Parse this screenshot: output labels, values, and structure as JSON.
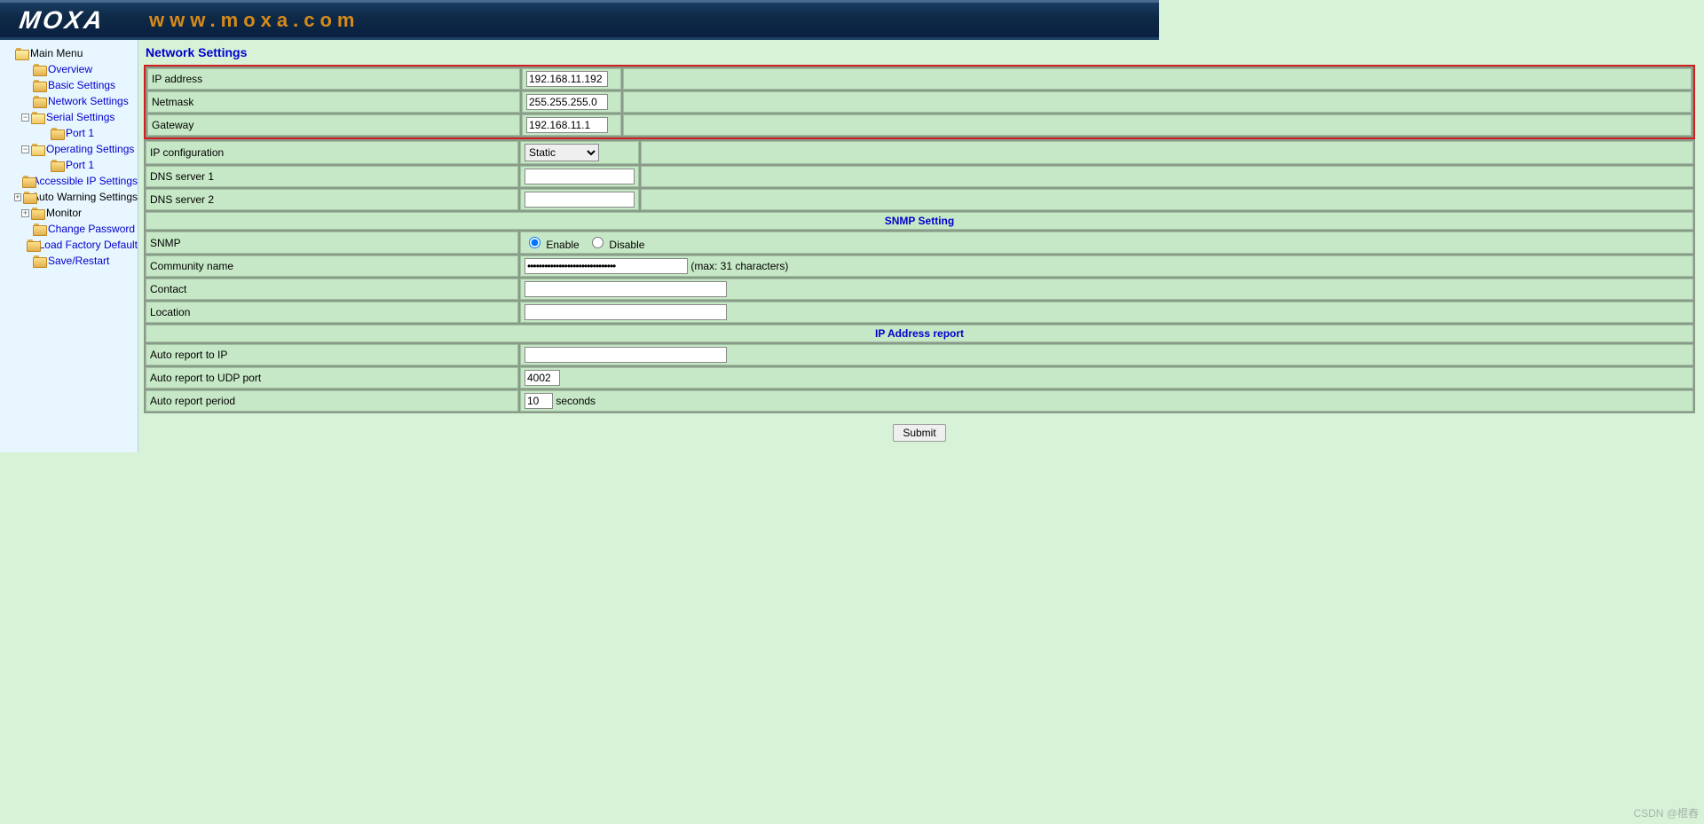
{
  "header": {
    "brand": "MOXA",
    "url": "www.moxa.com"
  },
  "sidebar": {
    "root": "Main Menu",
    "items": [
      {
        "label": "Overview",
        "indent": 1,
        "hasToggle": false
      },
      {
        "label": "Basic Settings",
        "indent": 1,
        "hasToggle": false
      },
      {
        "label": "Network Settings",
        "indent": 1,
        "hasToggle": false
      },
      {
        "label": "Serial Settings",
        "indent": 1,
        "hasToggle": true,
        "toggle": "-",
        "open": true
      },
      {
        "label": "Port 1",
        "indent": 2,
        "hasToggle": false
      },
      {
        "label": "Operating Settings",
        "indent": 1,
        "hasToggle": true,
        "toggle": "-",
        "open": true
      },
      {
        "label": "Port 1",
        "indent": 2,
        "hasToggle": false
      },
      {
        "label": "Accessible IP Settings",
        "indent": 1,
        "hasToggle": false
      },
      {
        "label": "Auto Warning Settings",
        "indent": 1,
        "hasToggle": true,
        "toggle": "+",
        "plain": true
      },
      {
        "label": "Monitor",
        "indent": 1,
        "hasToggle": true,
        "toggle": "+",
        "plain": true
      },
      {
        "label": "Change Password",
        "indent": 1,
        "hasToggle": false
      },
      {
        "label": "Load Factory Default",
        "indent": 1,
        "hasToggle": false
      },
      {
        "label": "Save/Restart",
        "indent": 1,
        "hasToggle": false
      }
    ]
  },
  "page": {
    "title": "Network Settings",
    "rows": {
      "ip_address": {
        "label": "IP address",
        "value": "192.168.11.192"
      },
      "netmask": {
        "label": "Netmask",
        "value": "255.255.255.0"
      },
      "gateway": {
        "label": "Gateway",
        "value": "192.168.11.1"
      },
      "ip_config": {
        "label": "IP configuration",
        "value": "Static",
        "options": [
          "Static"
        ]
      },
      "dns1": {
        "label": "DNS server 1",
        "value": ""
      },
      "dns2": {
        "label": "DNS server 2",
        "value": ""
      }
    },
    "snmp": {
      "header": "SNMP Setting",
      "snmp_label": "SNMP",
      "enable": "Enable",
      "disable": "Disable",
      "selected": "enable",
      "community_label": "Community name",
      "community_value": "●●●●●●●●●●●●●●●●●●●●●●●●●●●●●●●",
      "community_hint": "(max: 31 characters)",
      "contact_label": "Contact",
      "contact_value": "",
      "location_label": "Location",
      "location_value": ""
    },
    "ipreport": {
      "header": "IP Address report",
      "auto_ip_label": "Auto report to IP",
      "auto_ip_value": "",
      "auto_udp_label": "Auto report to UDP port",
      "auto_udp_value": "4002",
      "auto_period_label": "Auto report period",
      "auto_period_value": "10",
      "auto_period_unit": "seconds"
    },
    "submit": "Submit"
  },
  "watermark": "CSDN @棍舂"
}
